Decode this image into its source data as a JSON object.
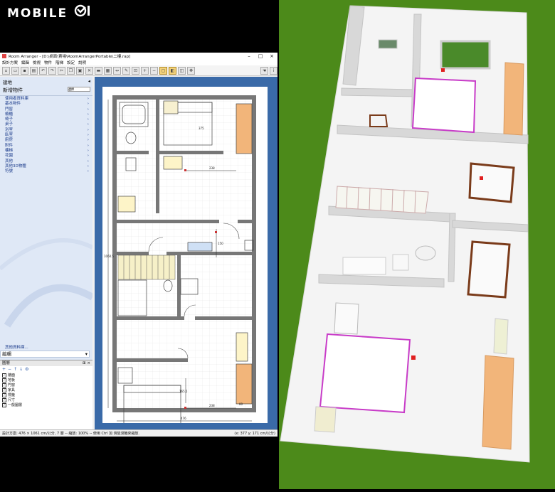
{
  "watermark": {
    "brand_text": "MOBILE"
  },
  "app": {
    "title": "Room Arranger - [D:\\桌面\\賣場\\RoomArrangerPortable\\二樓.rap]",
    "menu": [
      "設計方案",
      "編輯",
      "檢視",
      "物件",
      "階梯",
      "設定",
      "說明"
    ],
    "sidebar": {
      "section_title": "建地",
      "new_object_label": "新增物件",
      "search_button": "選擇",
      "categories": [
        "使用者資料庫",
        "基本物件",
        "門窗",
        "櫥櫃",
        "椅子",
        "桌子",
        "浴室",
        "臥室",
        "廚房",
        "附件",
        "樓梯",
        "花園",
        "其他",
        "其他3D物體",
        "符號"
      ],
      "more_label": "其他資料庫...",
      "edit_label": "編輯"
    },
    "layers": {
      "title": "圖層",
      "items": [
        "牆面",
        "地板",
        "門窗",
        "家具",
        "標籤",
        "尺寸",
        "一般圖層"
      ]
    },
    "status_left": "設計方案: 476 × 1061 cm/公分, 7 層 -- 縮放: 100% -- 使用 Ctrl 加 滑鼠滾輪來縮放.",
    "status_right": "(x: 377 y: 171 cm/公分)",
    "plan_labels": {
      "top_dim": "238",
      "mid_dim": "238",
      "stair_dim": "150",
      "bath_dim": "165.5",
      "width_dim": "476",
      "left_dim": "1060.5",
      "closet_dim": "80",
      "bed_dim": "375"
    }
  },
  "colors": {
    "sidebar_bg": "#dfe8f6",
    "canvas_bg": "#3a6aa8",
    "grass": "#4c8a1a",
    "wall": "#6a6a6a",
    "wardrobe": "#f2b57a",
    "accent_pink": "#c83cc8"
  }
}
